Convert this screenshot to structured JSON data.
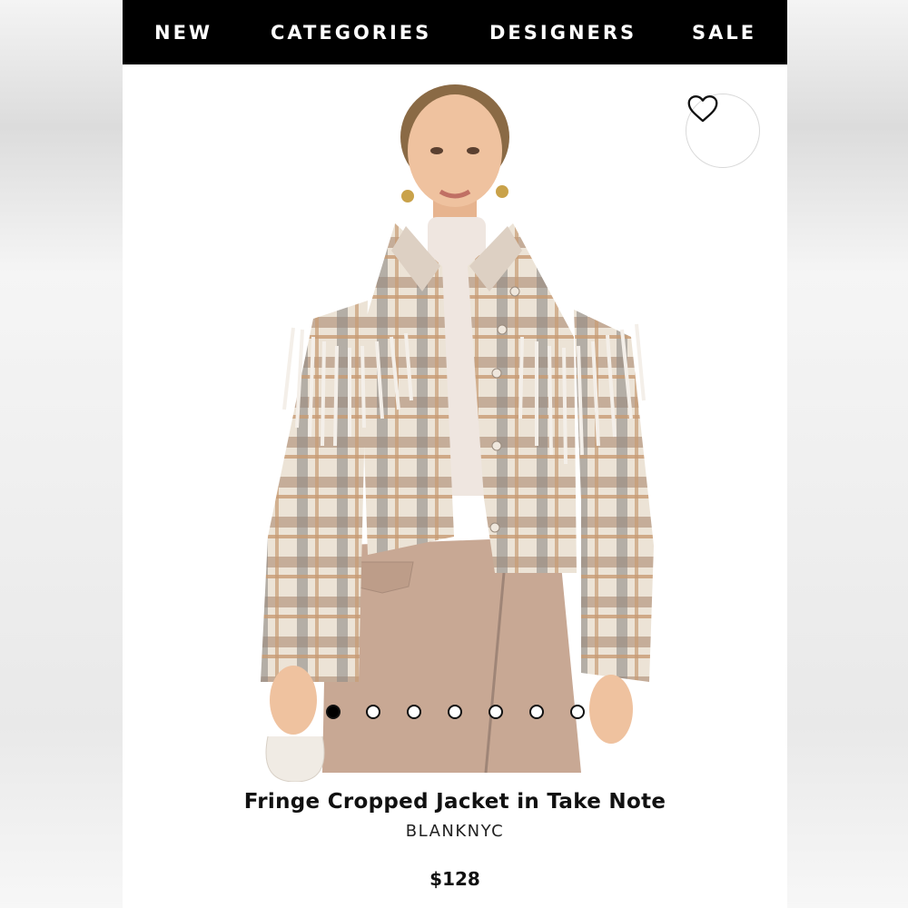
{
  "nav": {
    "items": [
      "NEW",
      "CATEGORIES",
      "DESIGNERS",
      "SALE"
    ]
  },
  "product": {
    "title": "Fringe Cropped Jacket in Take Note",
    "brand": "BLANKNYC",
    "price": "$128",
    "image_count": 7,
    "active_image_index": 0
  },
  "icons": {
    "wishlist": "heart-outline-icon"
  },
  "colors": {
    "nav_bg": "#000000",
    "nav_text": "#ffffff",
    "page_bg": "#ffffff",
    "text": "#111111"
  }
}
